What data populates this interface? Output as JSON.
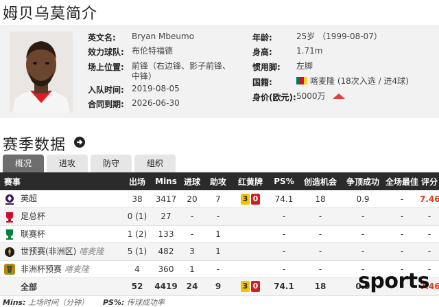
{
  "page": {
    "title": "姆贝乌莫简介"
  },
  "profile": {
    "english_name_label": "英文名:",
    "english_name": "Bryan Mbeumo",
    "club_label": "效力球队:",
    "club": "布伦特福德",
    "position_label": "场上位置:",
    "position_line1": "前锋（右边锋、影子前锋、",
    "position_line2": "中锋）",
    "joined_label": "入队时间:",
    "joined": "2019-08-05",
    "contract_label": "合同到期:",
    "contract": "2026-06-30",
    "age_label": "年龄:",
    "age": "25岁 （1999-08-07）",
    "height_label": "身高:",
    "height": "1.71m",
    "foot_label": "惯用脚:",
    "foot": "左脚",
    "nation_label": "国籍:",
    "nation": "喀麦隆 (18次入选 / 进4球)",
    "value_label": "身价(欧元):",
    "value": "5000万",
    "value_trend": "up",
    "flag_colors": [
      "#007a5e",
      "#ce1126",
      "#fcd116"
    ]
  },
  "stats": {
    "section_title": "赛季数据",
    "tabs": [
      {
        "label": "概况",
        "active": true
      },
      {
        "label": "进攻",
        "active": false
      },
      {
        "label": "防守",
        "active": false
      },
      {
        "label": "组织",
        "active": false
      }
    ],
    "headers": [
      "赛事",
      "出场",
      "Mins",
      "进球",
      "助攻",
      "红黄牌",
      "PS%",
      "创造机会",
      "争顶成功",
      "全场最佳",
      "评分"
    ],
    "rows": [
      {
        "comp": "英超",
        "note": "",
        "icon": "premier-league-icon",
        "apps": "38",
        "mins": "3417",
        "goals": "20",
        "assists": "7",
        "yellow": "3",
        "red": "0",
        "ps": "74.1",
        "chances": "18",
        "aerials": "0.9",
        "motm": "-",
        "rating": "7.46"
      },
      {
        "comp": "足总杯",
        "note": "",
        "icon": "fa-cup-icon",
        "apps": "0 (1)",
        "mins": "27",
        "goals": "-",
        "assists": "-",
        "yellow": "",
        "red": "",
        "ps": "-",
        "chances": "-",
        "aerials": "-",
        "motm": "-",
        "rating": "-"
      },
      {
        "comp": "联赛杯",
        "note": "",
        "icon": "league-cup-icon",
        "apps": "1 (2)",
        "mins": "133",
        "goals": "-",
        "assists": "1",
        "yellow": "",
        "red": "",
        "ps": "-",
        "chances": "-",
        "aerials": "-",
        "motm": "-",
        "rating": "-"
      },
      {
        "comp": "世预赛(非洲区)",
        "note": "喀麦隆",
        "icon": "wc-qualifier-icon",
        "apps": "5 (1)",
        "mins": "482",
        "goals": "3",
        "assists": "1",
        "yellow": "",
        "red": "",
        "ps": "-",
        "chances": "-",
        "aerials": "-",
        "motm": "-",
        "rating": "-"
      },
      {
        "comp": "非洲杯预赛",
        "note": "喀麦隆",
        "icon": "afcon-qualifier-icon",
        "apps": "4",
        "mins": "360",
        "goals": "1",
        "assists": "-",
        "yellow": "",
        "red": "",
        "ps": "-",
        "chances": "-",
        "aerials": "-",
        "motm": "-",
        "rating": "-"
      }
    ],
    "total": {
      "comp": "全部",
      "apps": "52",
      "mins": "4419",
      "goals": "24",
      "assists": "9",
      "yellow": "3",
      "red": "0",
      "ps": "74.1",
      "chances": "18",
      "aerials": "0.9",
      "motm": "-",
      "rating": "7.46"
    }
  },
  "footer": {
    "mins_key": "Mins:",
    "mins_desc": "上场时间（分钟）",
    "ps_key": "PS%:",
    "ps_desc": "传球成功率"
  },
  "watermark": "sports"
}
